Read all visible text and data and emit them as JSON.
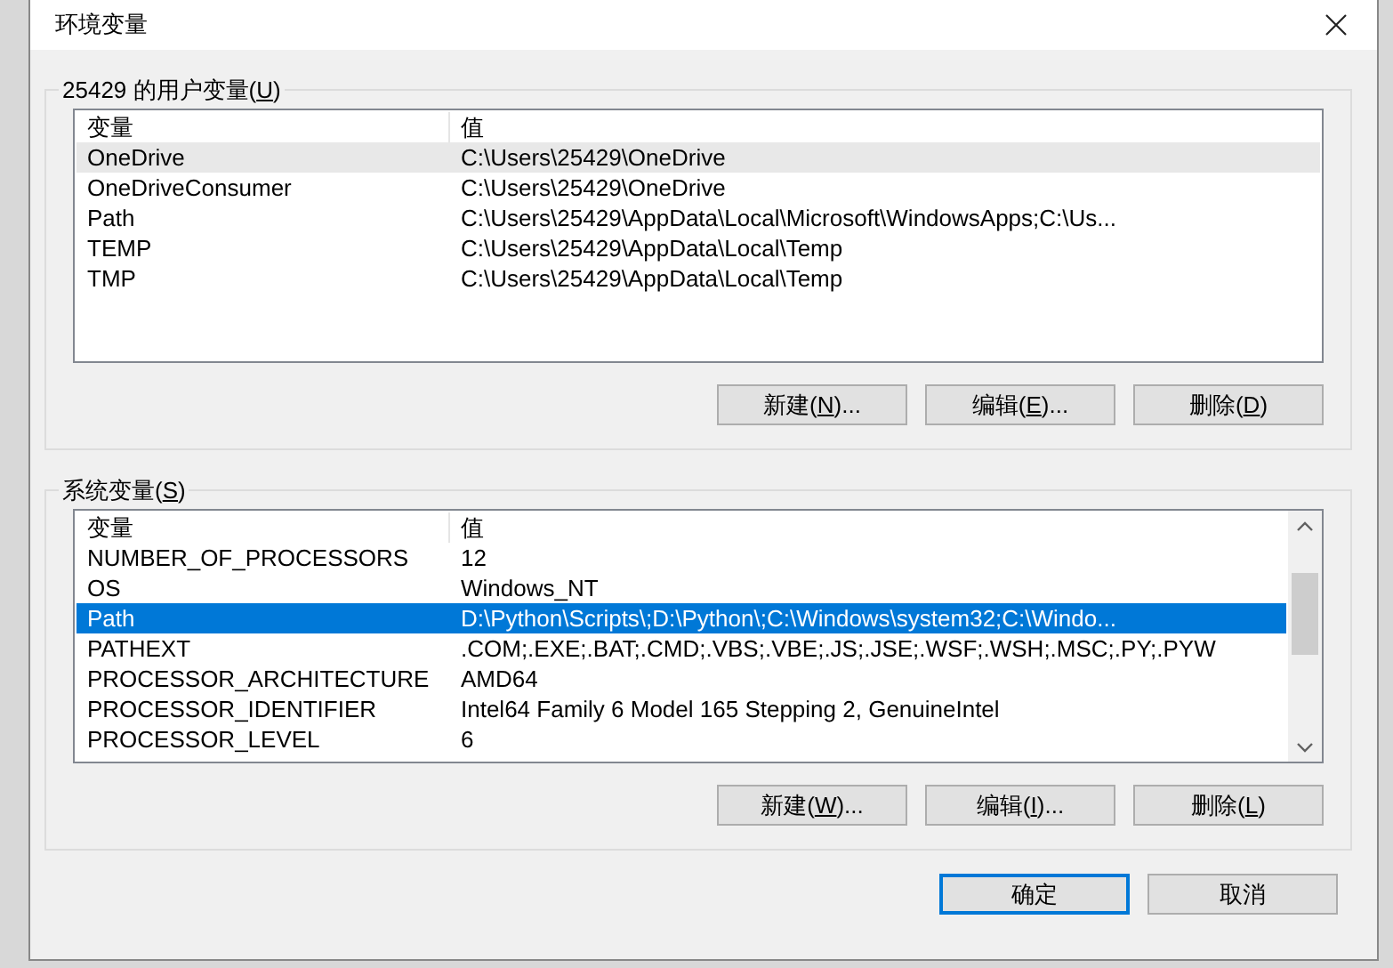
{
  "window": {
    "title": "环境变量"
  },
  "groups": [
    {
      "label": "25429 的用户变量(U)",
      "columns": [
        "变量",
        "值"
      ],
      "scrollbar": false,
      "rows": [
        {
          "name": "OneDrive",
          "value": "C:\\Users\\25429\\OneDrive",
          "selected": false,
          "hover": true
        },
        {
          "name": "OneDriveConsumer",
          "value": "C:\\Users\\25429\\OneDrive",
          "selected": false,
          "hover": false
        },
        {
          "name": "Path",
          "value": "C:\\Users\\25429\\AppData\\Local\\Microsoft\\WindowsApps;C:\\Us...",
          "selected": false,
          "hover": false
        },
        {
          "name": "TEMP",
          "value": "C:\\Users\\25429\\AppData\\Local\\Temp",
          "selected": false,
          "hover": false
        },
        {
          "name": "TMP",
          "value": "C:\\Users\\25429\\AppData\\Local\\Temp",
          "selected": false,
          "hover": false
        }
      ],
      "buttons": [
        "新建(N)...",
        "编辑(E)...",
        "删除(D)"
      ]
    },
    {
      "label": "系统变量(S)",
      "columns": [
        "变量",
        "值"
      ],
      "scrollbar": true,
      "rows": [
        {
          "name": "NUMBER_OF_PROCESSORS",
          "value": "12",
          "selected": false,
          "hover": false
        },
        {
          "name": "OS",
          "value": "Windows_NT",
          "selected": false,
          "hover": false
        },
        {
          "name": "Path",
          "value": "D:\\Python\\Scripts\\;D:\\Python\\;C:\\Windows\\system32;C:\\Windo...",
          "selected": true,
          "hover": false
        },
        {
          "name": "PATHEXT",
          "value": ".COM;.EXE;.BAT;.CMD;.VBS;.VBE;.JS;.JSE;.WSF;.WSH;.MSC;.PY;.PYW",
          "selected": false,
          "hover": false
        },
        {
          "name": "PROCESSOR_ARCHITECTURE",
          "value": "AMD64",
          "selected": false,
          "hover": false
        },
        {
          "name": "PROCESSOR_IDENTIFIER",
          "value": "Intel64 Family 6 Model 165 Stepping 2, GenuineIntel",
          "selected": false,
          "hover": false
        },
        {
          "name": "PROCESSOR_LEVEL",
          "value": "6",
          "selected": false,
          "hover": false
        }
      ],
      "buttons": [
        "新建(W)...",
        "编辑(I)...",
        "删除(L)"
      ]
    }
  ],
  "footer_buttons": [
    {
      "label": "确定",
      "default": true
    },
    {
      "label": "取消",
      "default": false
    }
  ]
}
